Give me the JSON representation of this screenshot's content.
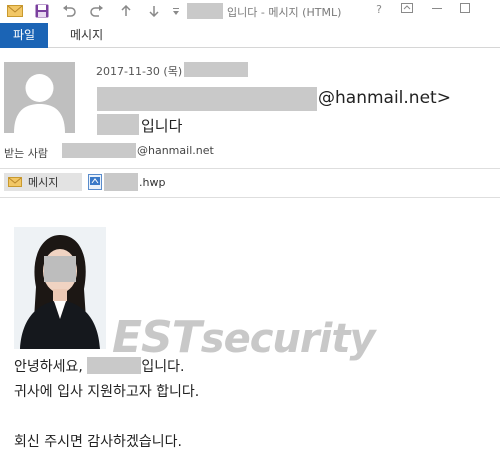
{
  "window": {
    "title": "입니다 - 메시지 (HTML)",
    "help": "?",
    "controls": [
      "ribbon-display",
      "minimize",
      "maximize"
    ]
  },
  "ribbon": {
    "tab_file": "파일",
    "tab_message": "메시지"
  },
  "header": {
    "date": "2017-11-30 (목)",
    "sender_domain": "@hanmail.net>",
    "subject_tail": "입니다",
    "to_label": "받는 사람",
    "to_domain": "@hanmail.net"
  },
  "attachments": {
    "message_label": "메시지",
    "file_ext": ".hwp"
  },
  "body": {
    "line1_head": "안녕하세요,",
    "line1_tail": "입니다.",
    "line2": "귀사에 입사 지원하고자 합니다.",
    "line3": "회신 주시면 감사하겠습니다."
  },
  "watermark": {
    "text1": "EST",
    "text2": "security"
  },
  "colors": {
    "file_tab": "#1b64b5",
    "redaction": "#c9c9c9",
    "watermark": "#c8c8c8"
  }
}
